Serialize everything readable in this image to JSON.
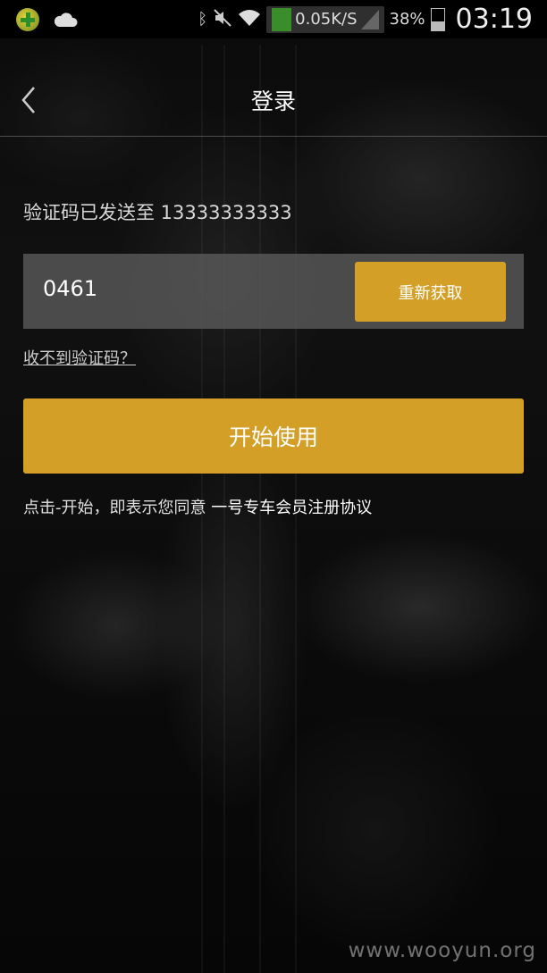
{
  "status_bar": {
    "speed": "0.05K/S",
    "battery": "38%",
    "battery_level": 0.38,
    "time": "03:19",
    "icons": [
      "app-notification-icon",
      "cloud-icon",
      "bluetooth-icon",
      "mute-icon",
      "wifi-icon",
      "signal-icon",
      "battery-icon"
    ]
  },
  "navbar": {
    "title": "登录",
    "back_icon": "chevron-left-icon"
  },
  "verification": {
    "sent_to": "验证码已发送至 13333333333",
    "code_value": "0461",
    "resend_label": "重新获取",
    "no_code_link": "收不到验证码？"
  },
  "actions": {
    "start_label": "开始使用"
  },
  "agreement": {
    "prefix": "点击-开始，即表示您同意 ",
    "link": "一号专车会员注册协议"
  },
  "watermark": "www.wooyun.org",
  "colors": {
    "accent": "#d39f26",
    "input_bg": "#5f5f5f"
  }
}
